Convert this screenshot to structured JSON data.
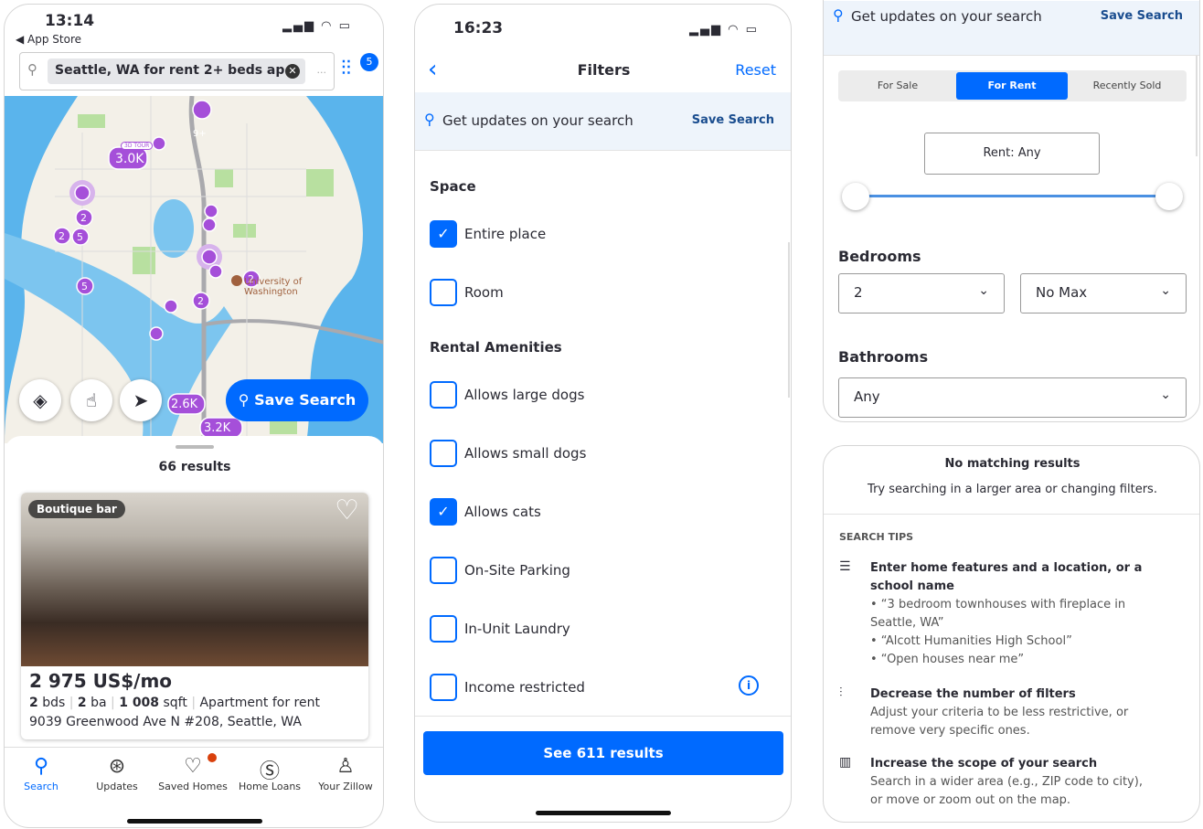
{
  "screen1": {
    "status": {
      "time": "13:14",
      "back": "◀ App Store"
    },
    "search": {
      "query": "Seattle, WA for rent 2+ beds ap...",
      "more": "...",
      "filter_count": "5"
    },
    "map": {
      "pins": [
        "9+",
        "3.0K",
        "2",
        "2",
        "5",
        "2",
        "5",
        "2",
        "2.6K",
        "3.2K",
        "2",
        "9+"
      ],
      "tour_label": "3D TOUR",
      "landmark": "University of Washington"
    },
    "save_search": "Save Search",
    "results": "66 results",
    "listing": {
      "tag": "Boutique bar",
      "price": "2 975 US$/mo",
      "beds": "2",
      "beds_unit": "bds",
      "baths": "2",
      "baths_unit": "ba",
      "sqft": "1 008",
      "sqft_unit": "sqft",
      "type": "Apartment for rent",
      "address": "9039 Greenwood Ave N #208, Seattle, WA"
    },
    "tabs": [
      {
        "label": "Search",
        "icon": "search-icon"
      },
      {
        "label": "Updates",
        "icon": "updates-icon"
      },
      {
        "label": "Saved Homes",
        "icon": "heart-icon"
      },
      {
        "label": "Home Loans",
        "icon": "dollar-icon"
      },
      {
        "label": "Your Zillow",
        "icon": "person-icon"
      }
    ],
    "colors": {
      "accent": "#006aff",
      "pin": "#a54fd9",
      "notify": "#d9400c"
    }
  },
  "screen2": {
    "status": {
      "time": "16:23"
    },
    "title": "Filters",
    "reset": "Reset",
    "banner": {
      "text": "Get updates on your search",
      "action": "Save Search"
    },
    "space": {
      "title": "Space",
      "items": [
        {
          "label": "Entire place",
          "checked": true
        },
        {
          "label": "Room",
          "checked": false
        }
      ]
    },
    "amenities": {
      "title": "Rental Amenities",
      "items": [
        {
          "label": "Allows large dogs",
          "checked": false
        },
        {
          "label": "Allows small dogs",
          "checked": false
        },
        {
          "label": "Allows cats",
          "checked": true
        },
        {
          "label": "On-Site Parking",
          "checked": false
        },
        {
          "label": "In-Unit Laundry",
          "checked": false
        },
        {
          "label": "Income restricted",
          "checked": false
        }
      ]
    },
    "cta": "See 611 results"
  },
  "screen3": {
    "banner": {
      "text": "Get updates on your search",
      "action": "Save Search"
    },
    "segments": [
      {
        "label": "For Sale",
        "active": false
      },
      {
        "label": "For Rent",
        "active": true
      },
      {
        "label": "Recently Sold",
        "active": false
      }
    ],
    "rent": {
      "label": "Rent: Any",
      "min_pct": 0,
      "max_pct": 100
    },
    "bedrooms": {
      "title": "Bedrooms",
      "min": "2",
      "max": "No Max"
    },
    "bathrooms": {
      "title": "Bathrooms",
      "value": "Any"
    },
    "empty": {
      "title": "No matching results",
      "subtitle": "Try searching in a larger area or changing filters."
    },
    "tips": {
      "title": "SEARCH TIPS",
      "items": [
        {
          "icon": "list-icon",
          "title": "Enter home features and a location, or a school name",
          "lines": [
            "• “3 bedroom townhouses with fireplace in Seattle, WA”",
            "• “Alcott Humanities High School”",
            "• “Open houses near me”"
          ]
        },
        {
          "icon": "sliders-icon",
          "title": "Decrease the number of filters",
          "lines": [
            "Adjust your criteria to be less restrictive, or remove very specific ones."
          ]
        },
        {
          "icon": "map-icon",
          "title": "Increase the scope of your search",
          "lines": [
            "Search in a wider area (e.g., ZIP code to city), or move or zoom out on the map."
          ]
        }
      ]
    }
  }
}
